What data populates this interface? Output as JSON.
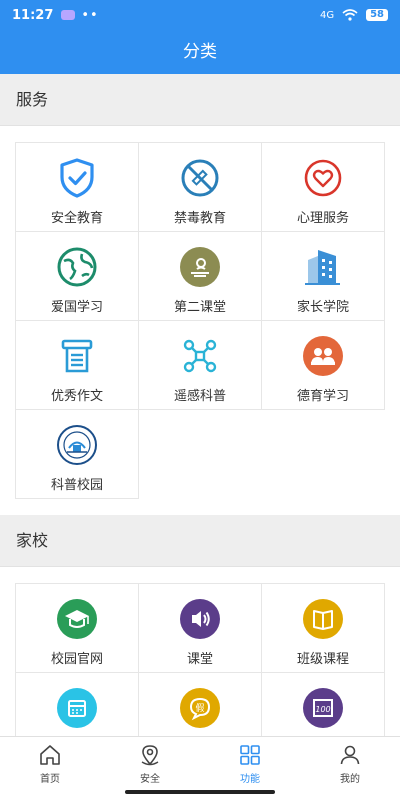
{
  "status": {
    "time": "11:27",
    "dots": "••",
    "signal": "4G",
    "battery": "58"
  },
  "header": {
    "title": "分类"
  },
  "sections": [
    {
      "title": "服务",
      "items": [
        {
          "label": "安全教育",
          "icon": "shield-check-icon"
        },
        {
          "label": "禁毒教育",
          "icon": "no-syringe-icon"
        },
        {
          "label": "心理服务",
          "icon": "heart-icon"
        },
        {
          "label": "爱国学习",
          "icon": "globe-icon"
        },
        {
          "label": "第二课堂",
          "icon": "classroom-icon"
        },
        {
          "label": "家长学院",
          "icon": "building-icon"
        },
        {
          "label": "优秀作文",
          "icon": "document-icon"
        },
        {
          "label": "遥感科普",
          "icon": "drone-icon"
        },
        {
          "label": "德育学习",
          "icon": "people-icon"
        },
        {
          "label": "科普校园",
          "icon": "school-logo-icon"
        }
      ]
    },
    {
      "title": "家校",
      "items": [
        {
          "label": "校园官网",
          "icon": "graduation-cap-icon"
        },
        {
          "label": "课堂",
          "icon": "speaker-icon"
        },
        {
          "label": "班级课程",
          "icon": "book-icon"
        },
        {
          "label": "",
          "icon": "calendar-icon"
        },
        {
          "label": "",
          "icon": "leave-icon"
        },
        {
          "label": "",
          "icon": "score-icon"
        }
      ]
    }
  ],
  "tabbar": [
    {
      "label": "首页",
      "icon": "home-icon"
    },
    {
      "label": "安全",
      "icon": "location-icon"
    },
    {
      "label": "功能",
      "icon": "grid-icon",
      "active": true
    },
    {
      "label": "我的",
      "icon": "person-icon"
    }
  ],
  "colors": {
    "primary": "#2f8ff0",
    "green": "#2a9d58",
    "purple": "#5b3d8a",
    "gold": "#e0a800",
    "cyan": "#2ac3e6"
  }
}
